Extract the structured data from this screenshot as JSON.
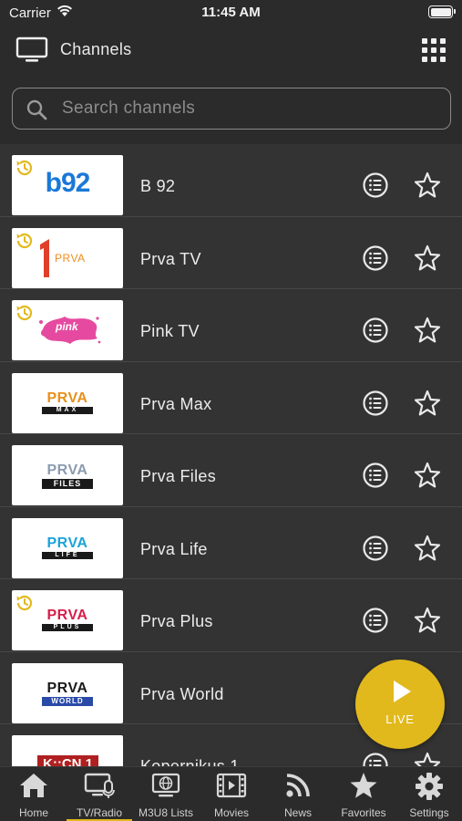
{
  "status_bar": {
    "carrier": "Carrier",
    "time": "11:45 AM"
  },
  "header": {
    "title": "Channels",
    "tv_icon": "tv-icon",
    "grid_icon": "grid-icon"
  },
  "search": {
    "placeholder": "Search channels",
    "value": ""
  },
  "channels": [
    {
      "name": "B 92",
      "logo_text": "b92",
      "recent": true
    },
    {
      "name": "Prva TV",
      "logo_text": "PRVA",
      "recent": true
    },
    {
      "name": "Pink TV",
      "logo_text": "pink",
      "recent": true
    },
    {
      "name": "Prva Max",
      "logo_text": "PRVA",
      "logo_sub": "MAX",
      "recent": false
    },
    {
      "name": "Prva Files",
      "logo_text": "PRVA",
      "logo_sub": "FILES",
      "recent": false
    },
    {
      "name": "Prva Life",
      "logo_text": "PRVA",
      "logo_sub": "LIFE",
      "recent": false
    },
    {
      "name": "Prva Plus",
      "logo_text": "PRVA",
      "logo_sub": "PLUS",
      "recent": true
    },
    {
      "name": "Prva World",
      "logo_text": "PRVA",
      "logo_sub": "WORLD",
      "recent": false
    },
    {
      "name": "Kopernikus 1",
      "logo_text": "K::CN 1",
      "recent": false
    }
  ],
  "live_button": {
    "label": "LIVE"
  },
  "tabs": [
    {
      "label": "Home",
      "icon": "home-icon"
    },
    {
      "label": "TV/Radio",
      "icon": "tv-radio-icon",
      "active": true
    },
    {
      "label": "M3U8 Lists",
      "icon": "m3u8-list-icon"
    },
    {
      "label": "Movies",
      "icon": "movies-icon"
    },
    {
      "label": "News",
      "icon": "rss-icon"
    },
    {
      "label": "Favorites",
      "icon": "star-icon"
    },
    {
      "label": "Settings",
      "icon": "gear-icon"
    }
  ],
  "colors": {
    "background": "#2b2b2b",
    "row_background": "#333333",
    "accent": "#e2b91c",
    "b92_blue": "#1a78d8",
    "prva_orange": "#f28c1e",
    "prva_max": "#e8901a",
    "prva_files": "#8a9bb0",
    "prva_life": "#1aa3d8",
    "prva_plus": "#d81e4a",
    "prva_world": "#2a4aa8",
    "pink": "#e64aa0"
  }
}
